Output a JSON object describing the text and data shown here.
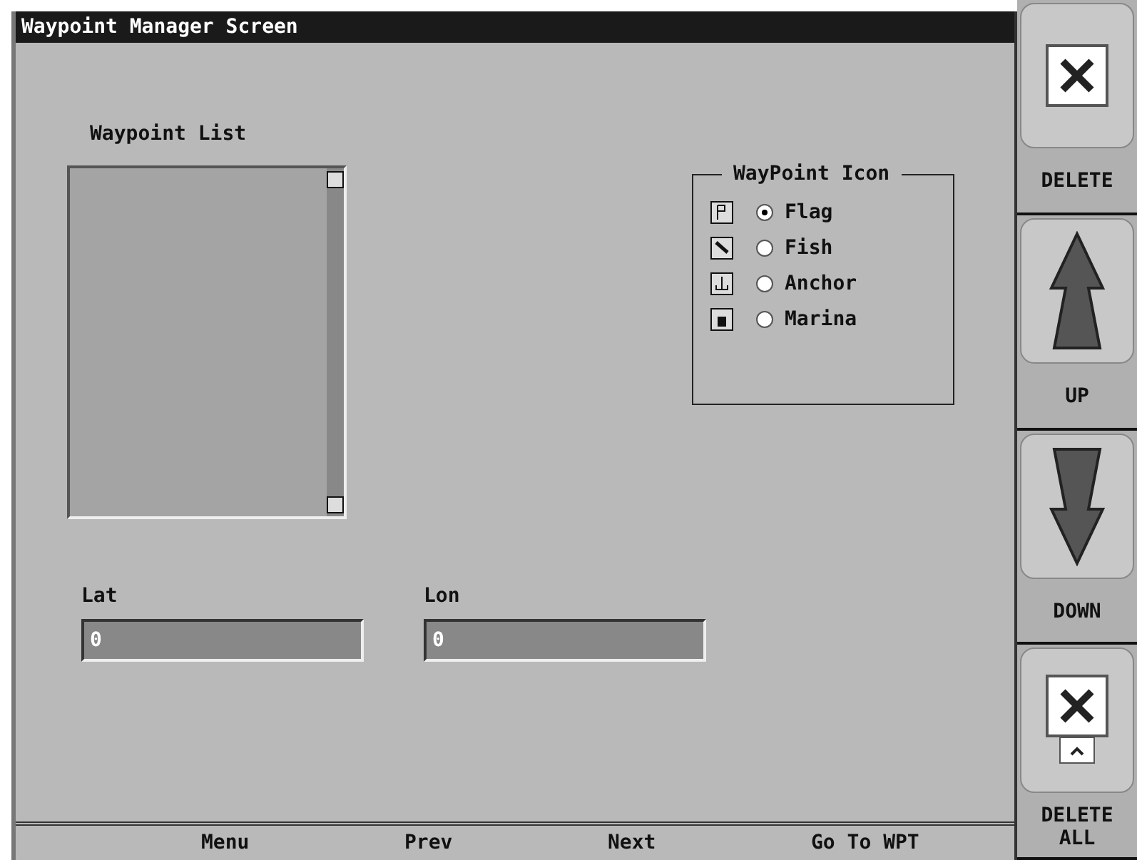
{
  "window": {
    "title": "Waypoint Manager Screen"
  },
  "waypoint_list": {
    "label": "Waypoint List"
  },
  "icon_group": {
    "title": "WayPoint Icon",
    "options": [
      {
        "kind": "flag",
        "label": "Flag",
        "selected": true
      },
      {
        "kind": "fish",
        "label": "Fish",
        "selected": false
      },
      {
        "kind": "anchor",
        "label": "Anchor",
        "selected": false
      },
      {
        "kind": "marina",
        "label": "Marina",
        "selected": false
      }
    ]
  },
  "fields": [
    {
      "label": "Lat",
      "value": "0"
    },
    {
      "label": "Lon",
      "value": "0"
    }
  ],
  "footer": [
    "Menu",
    "Prev",
    "Next",
    "Go To WPT"
  ],
  "side_buttons": [
    {
      "kind": "delete",
      "label": "DELETE"
    },
    {
      "kind": "up",
      "label": "UP"
    },
    {
      "kind": "down",
      "label": "DOWN"
    },
    {
      "kind": "delete_all",
      "label": "DELETE ALL"
    }
  ]
}
